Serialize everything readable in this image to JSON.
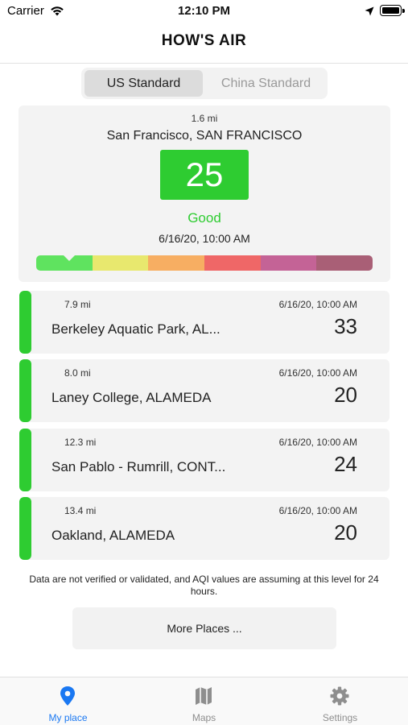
{
  "status_bar": {
    "carrier": "Carrier",
    "time": "12:10 PM",
    "icons": [
      "wifi-icon",
      "location-arrow-icon",
      "battery-icon"
    ]
  },
  "nav": {
    "title": "HOW'S AIR"
  },
  "segmented": {
    "options": [
      "US Standard",
      "China Standard"
    ],
    "selected": "US Standard"
  },
  "current": {
    "distance": "1.6 mi",
    "location": "San Francisco, SAN FRANCISCO",
    "aqi": "25",
    "level": "Good",
    "time": "6/16/20, 10:00 AM",
    "scale_colors": [
      "#5fe35f",
      "#e8e86e",
      "#f7ae62",
      "#ef6767",
      "#c46396",
      "#a95f76"
    ],
    "level_color": "#2ecc31"
  },
  "stations": [
    {
      "distance": "7.9 mi",
      "time": "6/16/20, 10:00 AM",
      "name": "Berkeley Aquatic Park, AL...",
      "aqi": "33"
    },
    {
      "distance": "8.0 mi",
      "time": "6/16/20, 10:00 AM",
      "name": "Laney College, ALAMEDA",
      "aqi": "20"
    },
    {
      "distance": "12.3 mi",
      "time": "6/16/20, 10:00 AM",
      "name": "San Pablo - Rumrill, CONT...",
      "aqi": "24"
    },
    {
      "distance": "13.4 mi",
      "time": "6/16/20, 10:00 AM",
      "name": "Oakland, ALAMEDA",
      "aqi": "20"
    }
  ],
  "disclaimer": "Data are not verified or validated, and AQI values are assuming at this level for 24 hours.",
  "more_button": "More Places ...",
  "tabs": [
    {
      "label": "My place",
      "icon": "map-pin-icon",
      "active": true
    },
    {
      "label": "Maps",
      "icon": "map-icon",
      "active": false
    },
    {
      "label": "Settings",
      "icon": "gear-icon",
      "active": false
    }
  ],
  "colors": {
    "accent": "#1a78f2",
    "good": "#2ecc31",
    "inactive": "#8e8e8e"
  }
}
